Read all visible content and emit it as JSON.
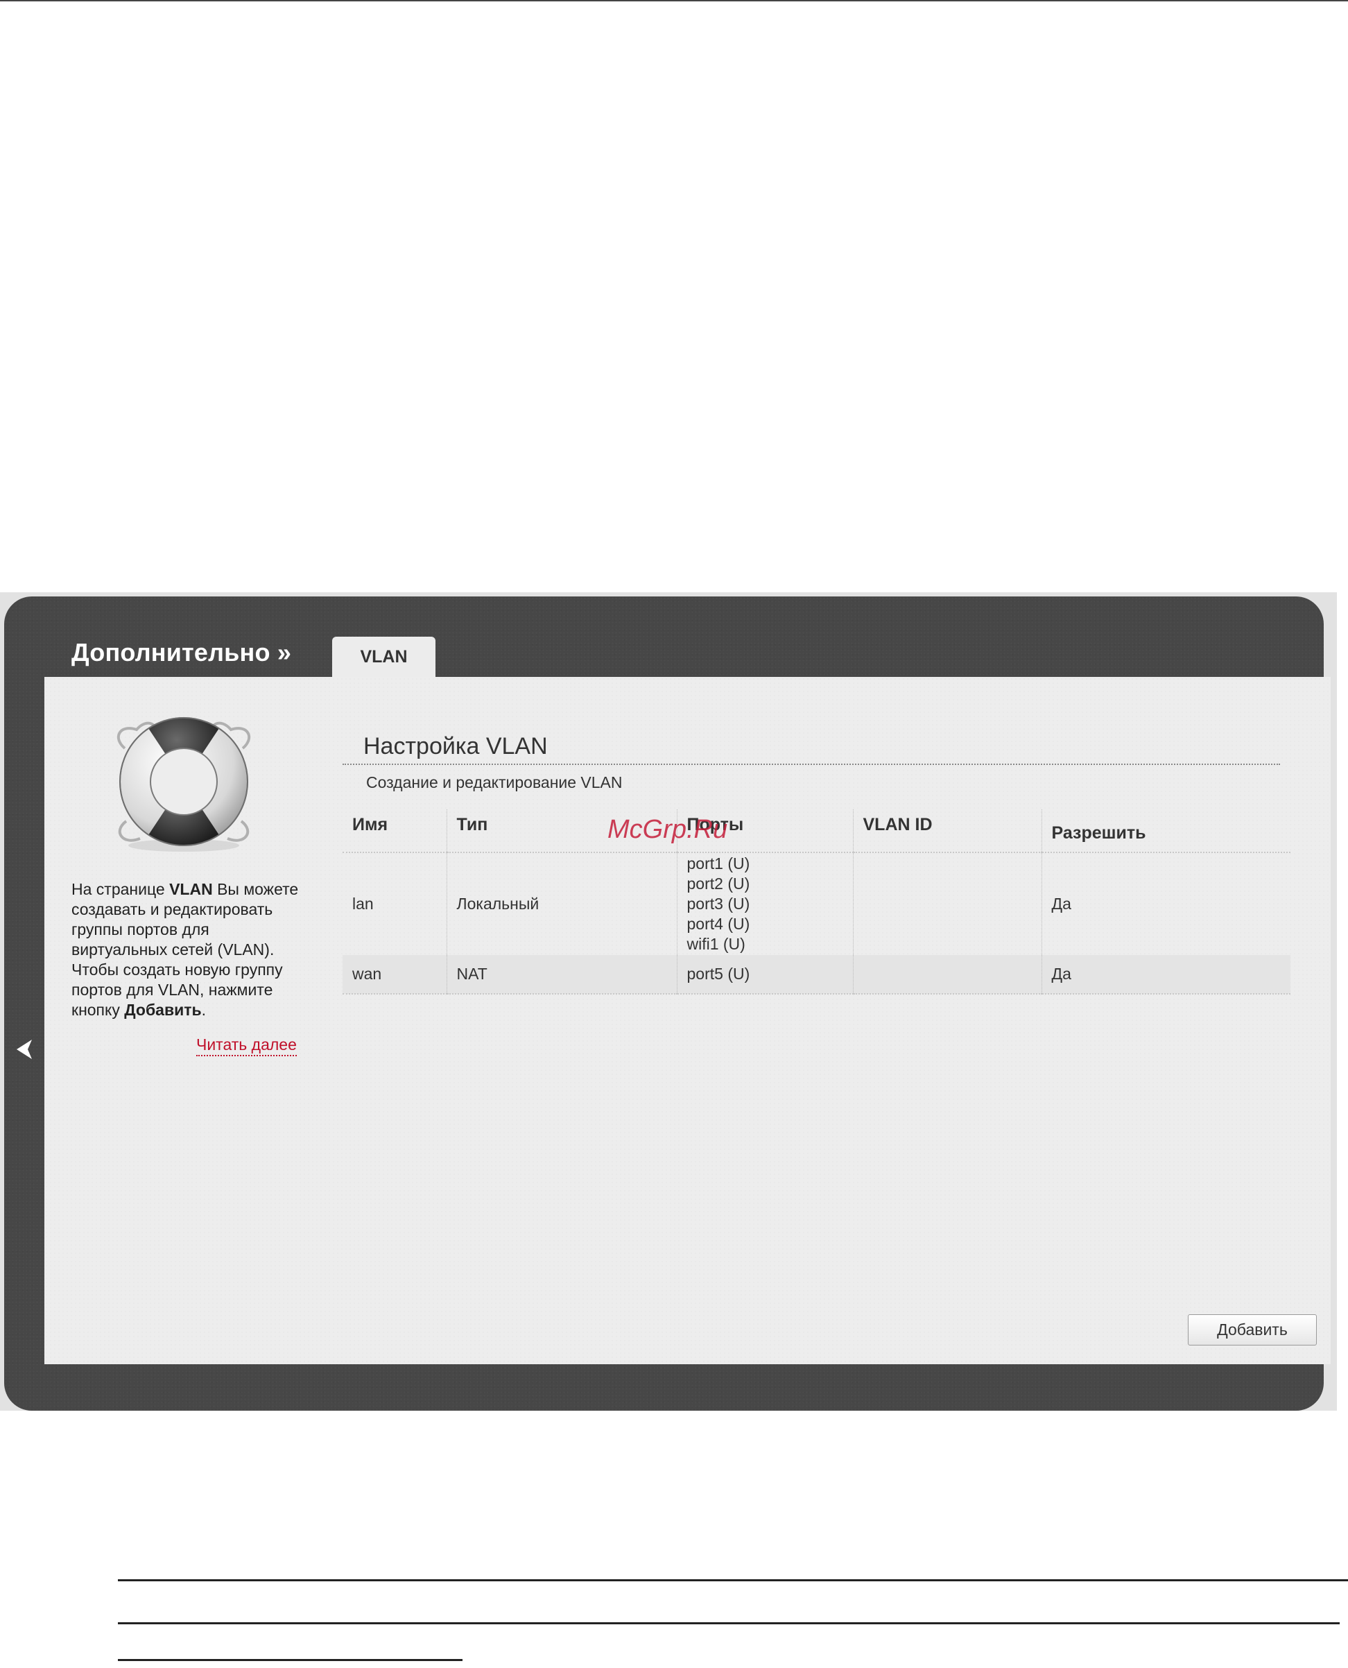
{
  "breadcrumb": {
    "section": "Дополнительно »",
    "tab": "VLAN"
  },
  "help": {
    "text_parts": [
      "На странице ",
      "VLAN",
      " Вы можете создавать и редактировать группы портов для виртуальных сетей (VLAN). Чтобы создать новую группу портов для VLAN, нажмите кнопку ",
      "Добавить",
      "."
    ],
    "read_more": "Читать далее",
    "icon": "lifebuoy-icon"
  },
  "main": {
    "title": "Настройка VLAN",
    "subtitle": "Создание и редактирование VLAN",
    "columns": [
      "Имя",
      "Тип",
      "Порты",
      "VLAN ID",
      "Разрешить"
    ],
    "rows": [
      {
        "name": "lan",
        "type": "Локальный",
        "ports": [
          "port1 (U)",
          "port2 (U)",
          "port3 (U)",
          "port4 (U)",
          "wifi1 (U)"
        ],
        "vlan_id": "",
        "allow": "Да"
      },
      {
        "name": "wan",
        "type": "NAT",
        "ports": [
          "port5 (U)"
        ],
        "vlan_id": "",
        "allow": "Да"
      }
    ],
    "add_button": "Добавить"
  },
  "watermark": "McGrp.Ru",
  "colors": {
    "panel": "#474747",
    "content": "#ededed",
    "link": "#c0102a",
    "watermark": "#c41e3a"
  }
}
